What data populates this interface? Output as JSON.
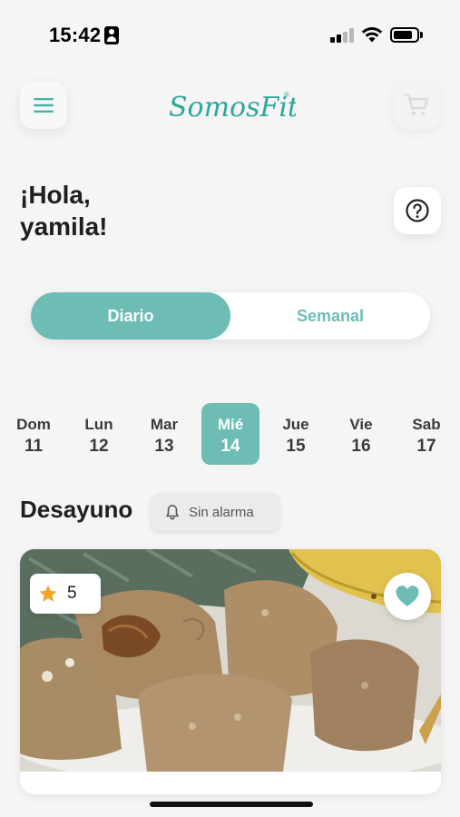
{
  "status_bar": {
    "time": "15:42",
    "battery_level": 0.85
  },
  "header": {
    "logo_text": "SomosFit",
    "logo_mark": "®",
    "menu_icon": "hamburger-menu-icon",
    "cart_icon": "shopping-cart-icon"
  },
  "greeting": {
    "line1": "¡Hola,",
    "line2": "yamila!",
    "help_icon": "question-circle-icon"
  },
  "view_toggle": {
    "options": [
      "Diario",
      "Semanal"
    ],
    "selected": "Diario"
  },
  "days": [
    {
      "name": "Dom",
      "date": "11",
      "active": false
    },
    {
      "name": "Lun",
      "date": "12",
      "active": false
    },
    {
      "name": "Mar",
      "date": "13",
      "active": false
    },
    {
      "name": "Mié",
      "date": "14",
      "active": true
    },
    {
      "name": "Jue",
      "date": "15",
      "active": false
    },
    {
      "name": "Vie",
      "date": "16",
      "active": false
    },
    {
      "name": "Sab",
      "date": "17",
      "active": false
    }
  ],
  "meal": {
    "title": "Desayuno",
    "alarm_label": "Sin alarma",
    "alarm_icon": "bell-icon"
  },
  "recipe_card": {
    "rating": "5",
    "rating_icon": "star-icon",
    "favorite_icon": "heart-icon",
    "image_description_icon": "muffins-photo"
  },
  "colors": {
    "accent": "#6dbdb4",
    "logo_teal": "#2ca79a",
    "background": "#f5f5f5",
    "star": "#f4a228",
    "text_dark": "#1f1f1f"
  }
}
